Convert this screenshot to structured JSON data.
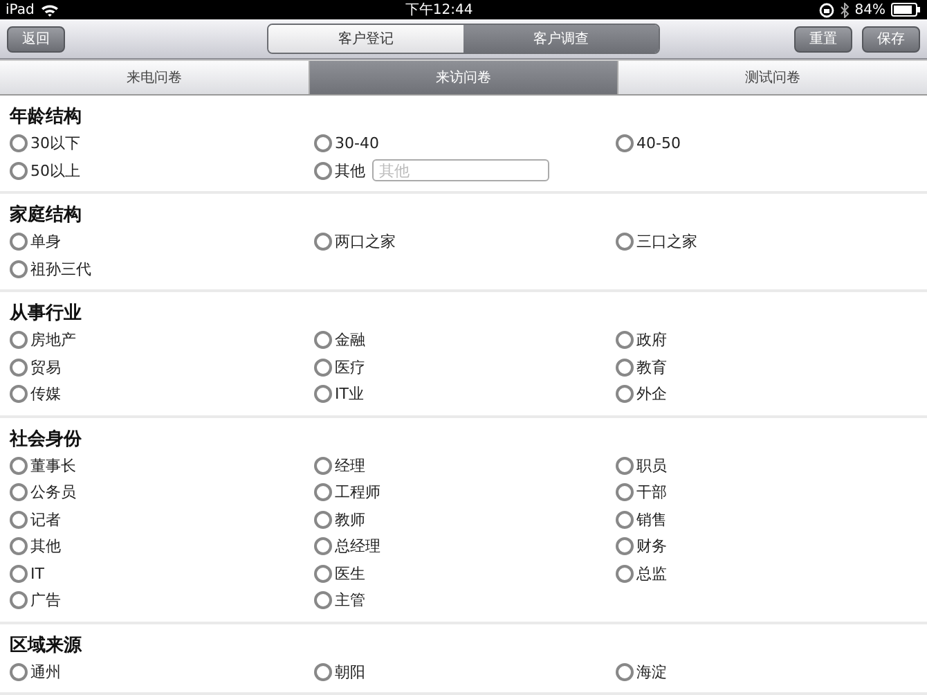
{
  "status_bar": {
    "device": "iPad",
    "time": "下午12:44",
    "battery": "84%"
  },
  "toolbar": {
    "back": "返回",
    "segments": [
      {
        "label": "客户登记",
        "selected": false
      },
      {
        "label": "客户调查",
        "selected": true
      }
    ],
    "buttons": [
      "重置",
      "保存"
    ]
  },
  "tabs": [
    {
      "label": "来电问卷",
      "selected": false
    },
    {
      "label": "来访问卷",
      "selected": true
    },
    {
      "label": "测试问卷",
      "selected": false
    }
  ],
  "sections": [
    {
      "title": "年龄结构",
      "options": [
        {
          "kind": "radio",
          "label": "30以下",
          "selected": false
        },
        {
          "kind": "radio",
          "label": "30-40",
          "selected": false
        },
        {
          "kind": "radio",
          "label": "40-50",
          "selected": false
        },
        {
          "kind": "radio",
          "label": "50以上",
          "selected": false
        },
        {
          "kind": "radio-field",
          "label": "其他",
          "selected": false,
          "placeholder": "其他"
        }
      ]
    },
    {
      "title": "家庭结构",
      "options": [
        {
          "kind": "radio",
          "label": "单身",
          "selected": false
        },
        {
          "kind": "radio",
          "label": "两口之家",
          "selected": false
        },
        {
          "kind": "radio",
          "label": "三口之家",
          "selected": false
        },
        {
          "kind": "radio",
          "label": "祖孙三代",
          "selected": false
        }
      ]
    },
    {
      "title": "从事行业",
      "options": [
        {
          "kind": "radio",
          "label": "房地产",
          "selected": false
        },
        {
          "kind": "radio",
          "label": "金融",
          "selected": false
        },
        {
          "kind": "radio",
          "label": "政府",
          "selected": false
        },
        {
          "kind": "radio",
          "label": "贸易",
          "selected": false
        },
        {
          "kind": "radio",
          "label": "医疗",
          "selected": false
        },
        {
          "kind": "radio",
          "label": "教育",
          "selected": false
        },
        {
          "kind": "radio",
          "label": "传媒",
          "selected": false
        },
        {
          "kind": "radio",
          "label": "IT业",
          "selected": false
        },
        {
          "kind": "radio",
          "label": "外企",
          "selected": false
        }
      ]
    },
    {
      "title": "社会身份",
      "options": [
        {
          "kind": "radio",
          "label": "董事长",
          "selected": false
        },
        {
          "kind": "radio",
          "label": "经理",
          "selected": false
        },
        {
          "kind": "radio",
          "label": "职员",
          "selected": false
        },
        {
          "kind": "radio",
          "label": "公务员",
          "selected": false
        },
        {
          "kind": "radio",
          "label": "工程师",
          "selected": false
        },
        {
          "kind": "radio",
          "label": "干部",
          "selected": false
        },
        {
          "kind": "radio",
          "label": "记者",
          "selected": false
        },
        {
          "kind": "radio",
          "label": "教师",
          "selected": false
        },
        {
          "kind": "radio",
          "label": "销售",
          "selected": false
        },
        {
          "kind": "radio",
          "label": "其他",
          "selected": false
        },
        {
          "kind": "radio",
          "label": "总经理",
          "selected": false
        },
        {
          "kind": "radio",
          "label": "财务",
          "selected": false
        },
        {
          "kind": "radio",
          "label": "IT",
          "selected": false
        },
        {
          "kind": "radio",
          "label": "医生",
          "selected": false
        },
        {
          "kind": "radio",
          "label": "总监",
          "selected": false
        },
        {
          "kind": "radio",
          "label": "广告",
          "selected": false
        },
        {
          "kind": "radio",
          "label": "主管",
          "selected": false
        }
      ]
    },
    {
      "title": "区域来源",
      "options": [
        {
          "kind": "radio",
          "label": "通州",
          "selected": false
        },
        {
          "kind": "radio",
          "label": "朝阳",
          "selected": false
        },
        {
          "kind": "radio",
          "label": "海淀",
          "selected": false
        }
      ]
    }
  ]
}
